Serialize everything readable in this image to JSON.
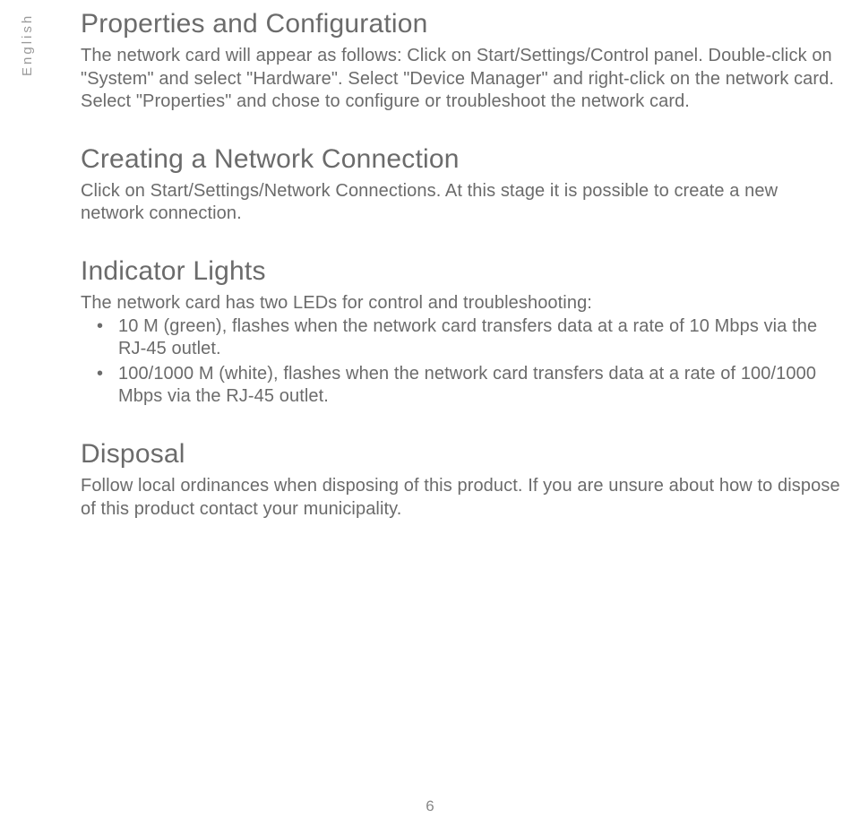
{
  "language_label": "English",
  "sections": {
    "properties": {
      "heading": "Properties and Configuration",
      "body": "The network card will appear as follows: Click on Start/Settings/Control panel. Double-click on \"System\" and select \"Hardware\". Select \"Device Manager\" and right-click on the network card. Select \"Properties\" and chose to configure or troubleshoot the network card."
    },
    "creating": {
      "heading": "Creating a Network Connection",
      "body": "Click on Start/Settings/Network Connections. At this stage it is possible to create a new network connection."
    },
    "indicator": {
      "heading": "Indicator Lights",
      "intro": "The network card has two LEDs for control and troubleshooting:",
      "bullets": [
        "10 M (green), flashes when the network card transfers data at a rate of 10 Mbps via the RJ-45 outlet.",
        "100/1000 M (white), flashes when the network card transfers data at a rate of 100/1000 Mbps via the RJ-45 outlet."
      ]
    },
    "disposal": {
      "heading": "Disposal",
      "body": "Follow local ordinances when disposing of this product. If you are unsure about how to dispose of this product contact your municipality."
    }
  },
  "page_number": "6"
}
